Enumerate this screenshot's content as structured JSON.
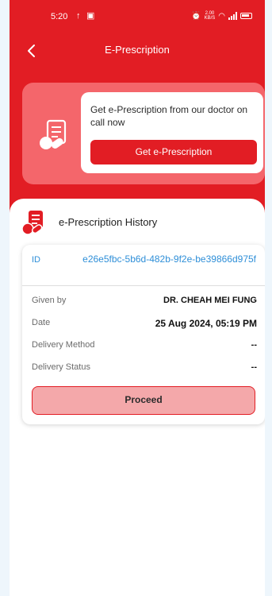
{
  "status_bar": {
    "time": "5:20",
    "network_speed": "2.00\nKB/S"
  },
  "nav": {
    "title": "E-Prescription",
    "back_icon": "chevron-left-icon"
  },
  "promo": {
    "text": "Get e-Prescription from our doctor on call now",
    "button_label": "Get e-Prescription",
    "icon": "prescription-icon"
  },
  "history": {
    "title": "e-Prescription History",
    "icon": "prescription-icon",
    "items": [
      {
        "id_label": "ID",
        "id_value": "e26e5fbc-5b6d-482b-9f2e-be39866d975f",
        "given_by_label": "Given by",
        "given_by_value": "DR. CHEAH MEI FUNG",
        "date_label": "Date",
        "date_value": "25 Aug 2024, 05:19 PM",
        "delivery_method_label": "Delivery Method",
        "delivery_method_value": "--",
        "delivery_status_label": "Delivery Status",
        "delivery_status_value": "--",
        "proceed_label": "Proceed"
      }
    ]
  },
  "colors": {
    "primary": "#e21d24",
    "promo_bg": "#f4666b",
    "link": "#2f8fd8",
    "proceed_bg": "#f4a8aa",
    "page_bg": "#eef6fc"
  }
}
